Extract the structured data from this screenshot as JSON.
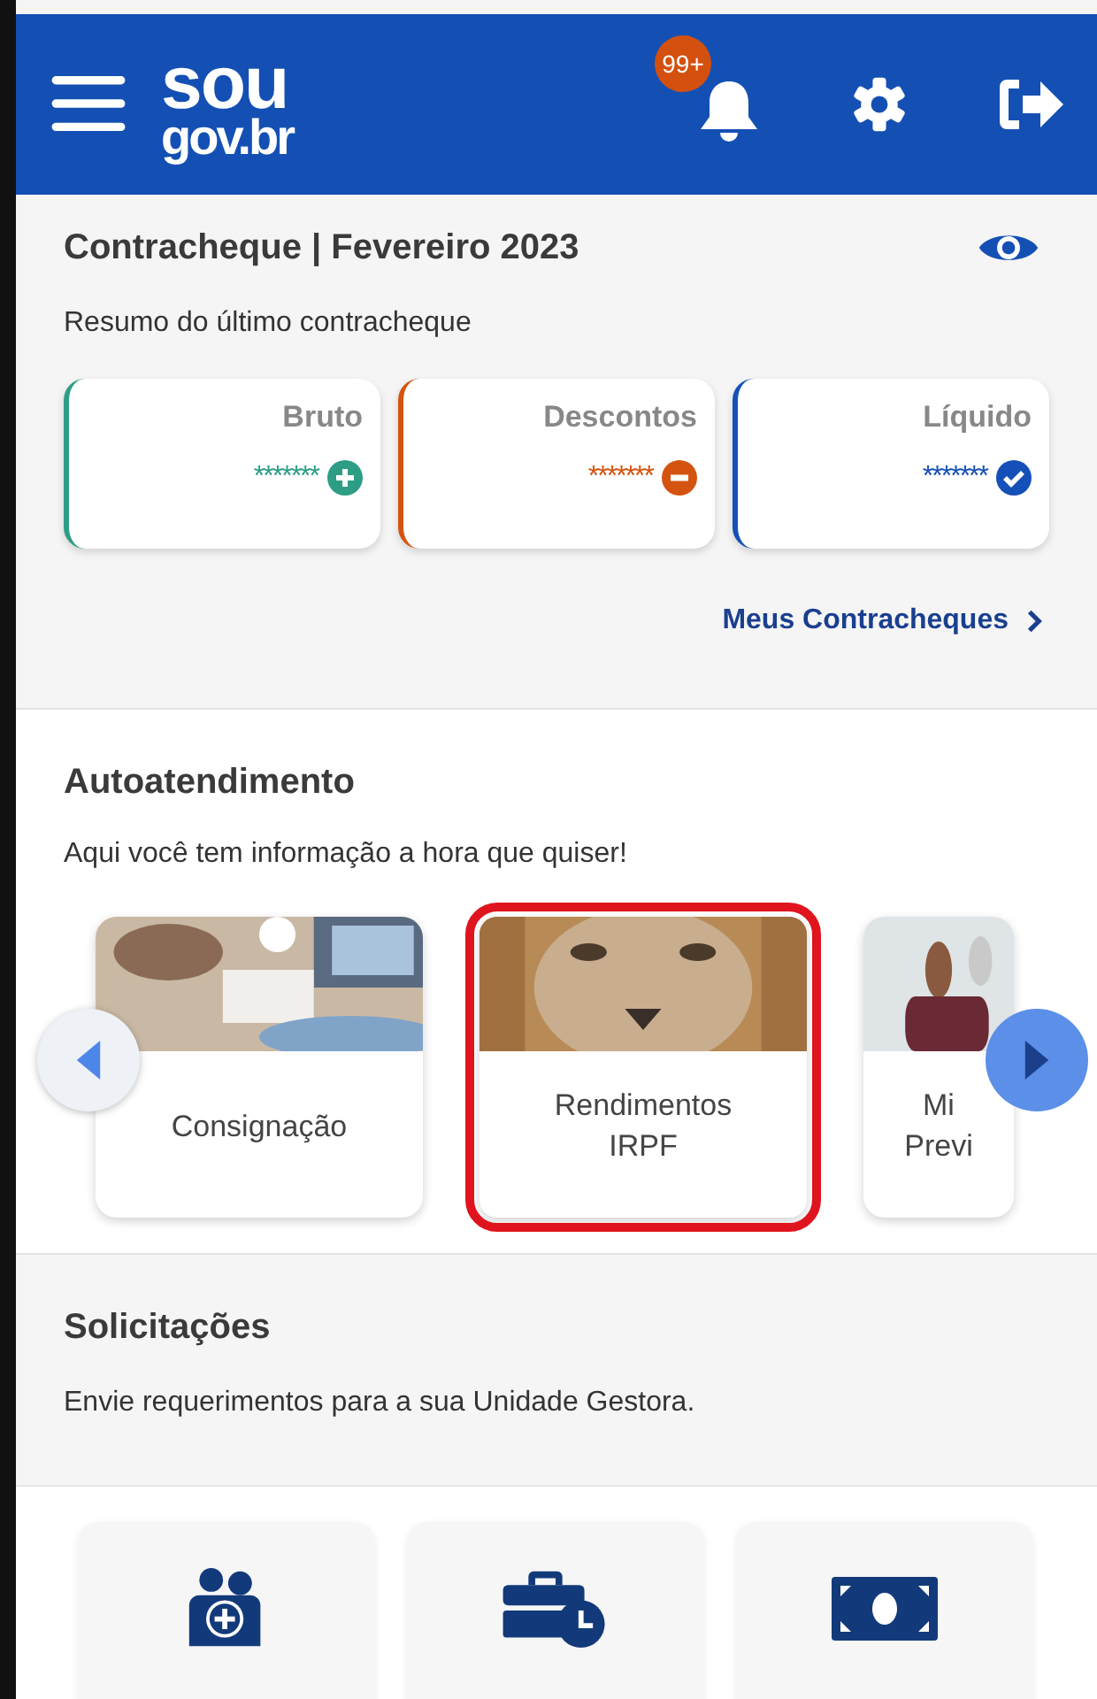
{
  "header": {
    "logo_top": "sou",
    "logo_bottom": "gov.br",
    "notification_badge": "99+"
  },
  "payslip": {
    "title": "Contracheque | Fevereiro 2023",
    "subtitle": "Resumo do último contracheque",
    "values_hidden": true,
    "cards": [
      {
        "label": "Bruto",
        "value": "*******",
        "kind": "plus",
        "color": "#2e9d85"
      },
      {
        "label": "Descontos",
        "value": "*******",
        "kind": "minus",
        "color": "#d4540f"
      },
      {
        "label": "Líquido",
        "value": "*******",
        "kind": "check",
        "color": "#1550b8"
      }
    ],
    "link": "Meus Contracheques"
  },
  "self_service": {
    "title": "Autoatendimento",
    "subtitle": "Aqui você tem informação a hora que quiser!",
    "cards": [
      {
        "lines": [
          "Consignação"
        ],
        "kind": "picture",
        "highlighted": false
      },
      {
        "lines": [
          "Rendimentos",
          "IRPF"
        ],
        "kind": "picture",
        "highlighted": true
      },
      {
        "lines": [
          "Mi",
          "Previ"
        ],
        "kind": "picture",
        "highlighted": false
      }
    ]
  },
  "requests": {
    "title": "Solicitações",
    "subtitle": "Envie requerimentos para a sua Unidade Gestora.",
    "tiles": [
      {
        "kind": "people-plus"
      },
      {
        "kind": "briefcase-clock"
      },
      {
        "kind": "money"
      }
    ]
  }
}
